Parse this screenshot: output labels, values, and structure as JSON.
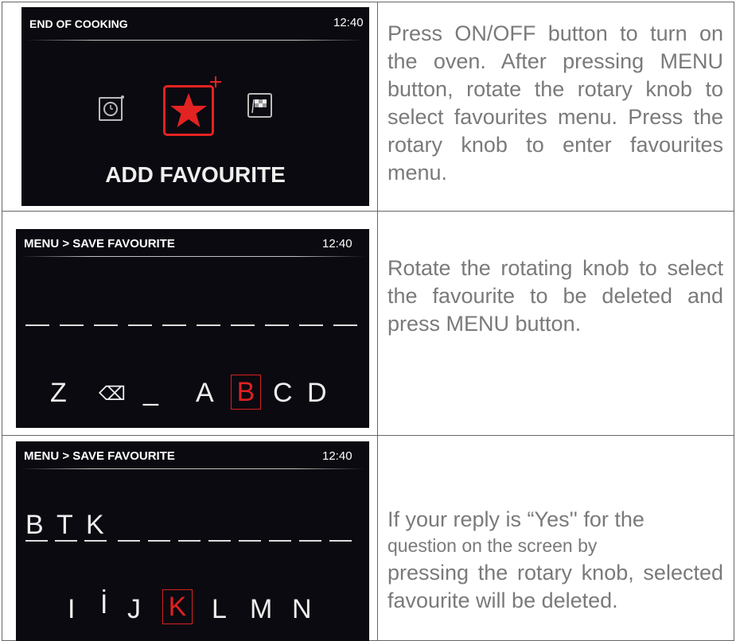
{
  "rows": [
    {
      "screen": {
        "header": "END OF COOKING",
        "clock": "12:40",
        "icons": [
          "timer-icon",
          "favourite-star-icon",
          "finish-flag-icon"
        ],
        "caption": "ADD FAVOURITE"
      },
      "description": "Press ON/OFF button to turn on the oven. After pressing MENU button, rotate the rotary knob to select favourites menu. Press the rotary knob to enter favourites menu."
    },
    {
      "screen": {
        "header": "MENU > SAVE FAVOURITE",
        "clock": "12:40",
        "name_slots": 10,
        "chars": [
          "Z",
          "⌫",
          "_",
          "A",
          "B",
          "C",
          "D"
        ],
        "selected": "B"
      },
      "description": "Rotate the rotating knob to select the favourite to be deleted and press MENU button."
    },
    {
      "screen": {
        "header": "MENU > SAVE FAVOURITE",
        "clock": "12:40",
        "typed": [
          "B",
          "T",
          "K"
        ],
        "chars": [
          "I",
          "İ",
          "J",
          "K",
          "L",
          "M",
          "N"
        ],
        "selected": "K"
      },
      "description_line1": "If your reply is “Yes'' for the",
      "description_line2": "question on the screen by",
      "description_rest": "pressing the rotary knob, selected favourite will be deleted."
    }
  ],
  "colors": {
    "accent": "#e32222",
    "screen_bg": "#0a0a10",
    "text": "#7a7a7a"
  }
}
